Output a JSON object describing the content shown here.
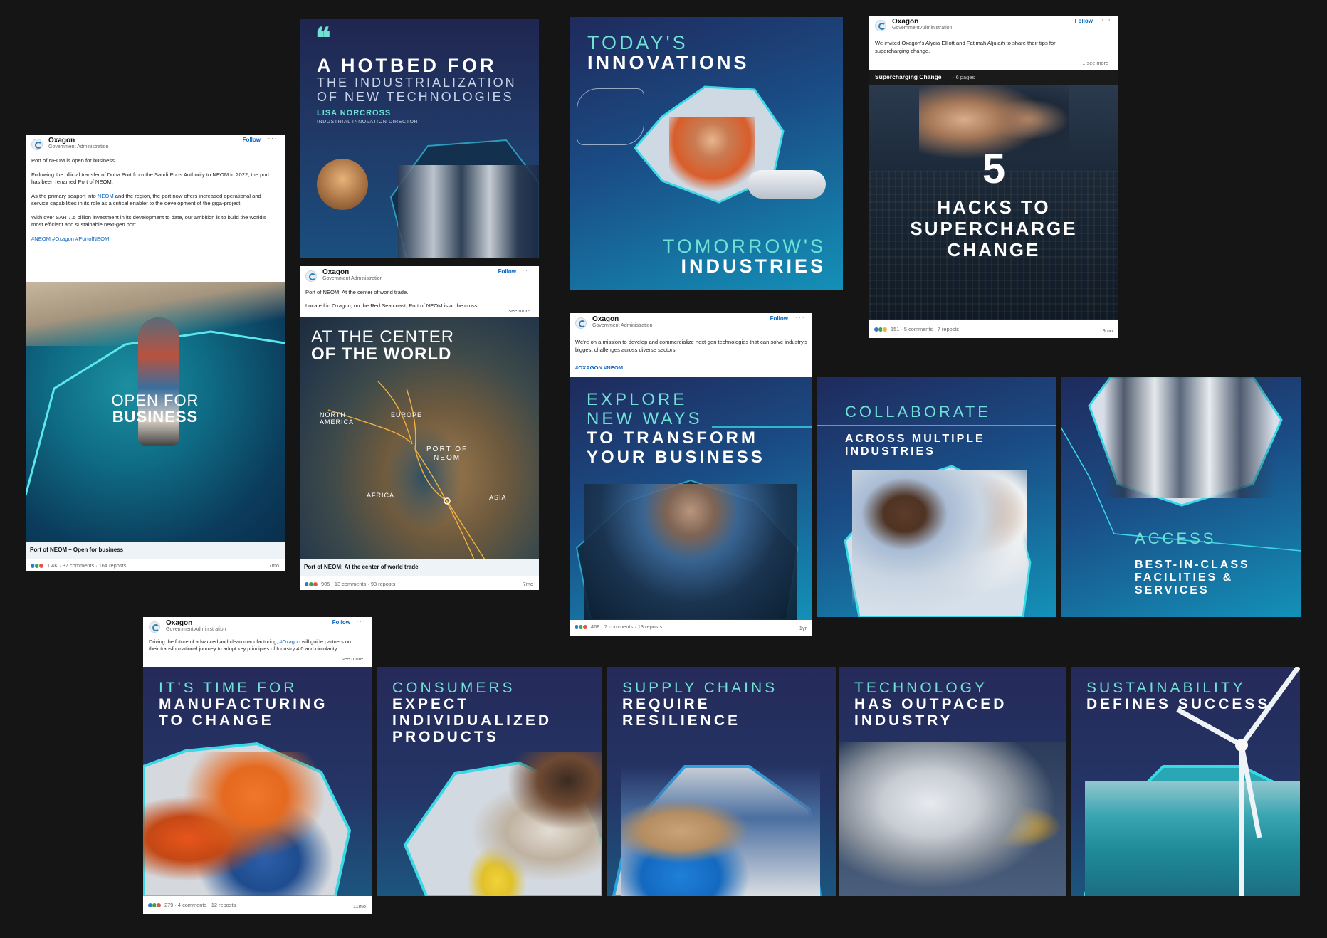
{
  "post_common": {
    "company": "Oxagon",
    "category": "Government Administration",
    "follow": "Follow",
    "more": "···",
    "see_more": "...see more"
  },
  "post1": {
    "paragraphs": [
      "Port of NEOM is open for business.",
      "Following the official transfer of Duba Port from the Saudi Ports Authority to NEOM in 2022, the port has been renamed Port of NEOM."
    ],
    "p3_before": "As the primary seaport into ",
    "p3_link": "NEOM",
    "p3_after": " and the region, the port now offers increased operational and service capabilities in its role as a critical enabler to the development of the giga-project.",
    "p4": "With over SAR 7.5 billion investment in its development to date, our ambition is to build the world's most efficient and sustainable next-gen port.",
    "hashtags": "#NEOM #Oxagon #PortofNEOM",
    "image_line1": "OPEN FOR",
    "image_line2": "BUSINESS",
    "caption": "Port of NEOM – Open for business",
    "stats": "1.4K · 37 comments · 164 reposts",
    "ago": "7mo"
  },
  "card_hotbed": {
    "quote_mark": "❝",
    "line1": "A HOTBED FOR",
    "line2": "THE INDUSTRIALIZATION",
    "line3": "OF NEW TECHNOLOGIES",
    "person": "LISA NORCROSS",
    "role": "INDUSTRIAL INNOVATION DIRECTOR"
  },
  "post2": {
    "line1": "Port of NEOM: At the center of world trade.",
    "line2": "Located in Oxagon, on the Red Sea coast, Port of NEOM is at the cross",
    "see_more": "...see more",
    "title1": "AT THE CENTER",
    "title2": "OF THE WORLD",
    "map_labels": {
      "north_america": "NORTH\nAMERICA",
      "europe": "EUROPE",
      "port": "PORT OF\nNEOM",
      "africa": "AFRICA",
      "asia": "ASIA"
    },
    "caption": "Port of NEOM: At the center of world trade",
    "stats": "905 · 13 comments · 93 reposts",
    "ago": "7mo"
  },
  "card_innovations": {
    "line1": "TODAY'S",
    "line2": "INNOVATIONS",
    "line3": "TOMORROW'S",
    "line4": "INDUSTRIES"
  },
  "post3": {
    "intro": "We invited Oxagon's Alycia Elliott and Fatimah Aljulaih to share their tips for supercharging change.",
    "see_more": "...see more",
    "doc_title": "Supercharging Change",
    "doc_pages": " · 6 pages",
    "big_number": "5",
    "line1": "HACKS TO",
    "line2": "SUPERCHARGE",
    "line3": "CHANGE",
    "stats": "151 · 5 comments · 7 reposts",
    "ago": "9mo"
  },
  "post4": {
    "intro": "We're on a mission to develop and commercialize next-gen technologies that can solve industry's biggest challenges across diverse sectors.",
    "hashtags": "#OXAGON #NEOM",
    "line1": "EXPLORE",
    "line2": "NEW WAYS",
    "line3": "TO TRANSFORM",
    "line4": "YOUR BUSINESS",
    "stats": "468 · 7 comments · 13 reposts",
    "ago": "1yr"
  },
  "carousel_collab": {
    "line1": "COLLABORATE",
    "line2": "ACROSS MULTIPLE",
    "line3": "INDUSTRIES"
  },
  "carousel_access": {
    "line1": "ACCESS",
    "line2": "BEST-IN-CLASS",
    "line3": "FACILITIES &",
    "line4": "SERVICES"
  },
  "post5": {
    "text_before": "Driving the future of advanced and clean manufacturing, ",
    "text_link": "#Oxagon",
    "text_after": " will guide partners on their transformational journey to adopt key principles of Industry 4.0 and circularity.",
    "see_more": "...see more",
    "line1": "IT'S TIME FOR",
    "line2": "MANUFACTURING",
    "line3": "TO CHANGE",
    "stats": "279 · 4 comments · 12 reposts",
    "ago": "11mo"
  },
  "carousel_consumers": {
    "line1": "CONSUMERS",
    "line2": "EXPECT",
    "line3": "INDIVIDUALIZED",
    "line4": "PRODUCTS"
  },
  "carousel_supply": {
    "line1": "SUPPLY CHAINS",
    "line2": "REQUIRE",
    "line3": "RESILIENCE"
  },
  "carousel_tech": {
    "line1": "TECHNOLOGY",
    "line2": "HAS OUTPACED",
    "line3": "INDUSTRY"
  },
  "carousel_sustain": {
    "line1": "SUSTAINABILITY",
    "line2": "DEFINES SUCCESS"
  },
  "colors": {
    "background": "#151515",
    "navy": "#222a5a",
    "cyan_text": "#6fe1d5",
    "hex_outline": "#38d9e3",
    "linkedin_blue": "#0a66c2"
  }
}
